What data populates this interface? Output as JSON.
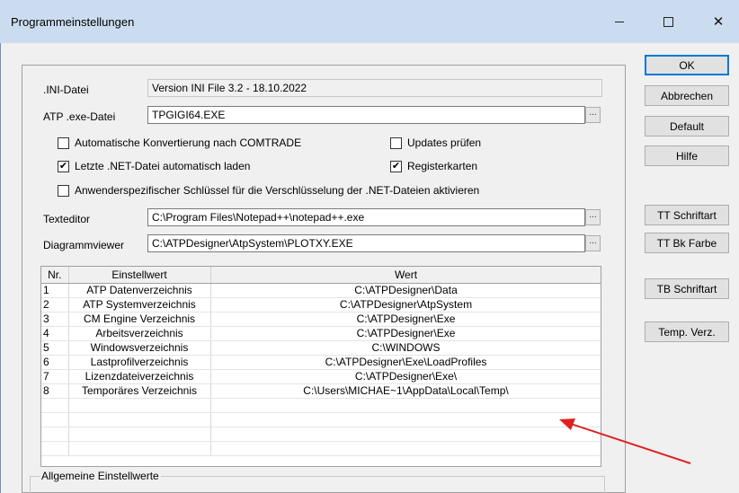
{
  "window": {
    "title": "Programmeinstellungen",
    "minimize": "—",
    "maximize": "",
    "close": "✕"
  },
  "ini": {
    "label": ".INI-Datei",
    "value": "Version INI File 3.2 - 18.10.2022"
  },
  "atp_exe": {
    "label": "ATP .exe-Datei",
    "value": "TPGIGI64.EXE",
    "browse": "..."
  },
  "checkboxes": {
    "auto_convert": {
      "label": "Automatische Konvertierung nach COMTRADE",
      "checked": false,
      "mark": ""
    },
    "updates": {
      "label": "Updates prüfen",
      "checked": false,
      "mark": ""
    },
    "last_net": {
      "label": "Letzte .NET-Datei automatisch laden",
      "checked": true,
      "mark": "✔"
    },
    "tabs": {
      "label": "Registerkarten",
      "checked": true,
      "mark": "✔"
    },
    "encryption": {
      "label": "Anwenderspezifischer Schlüssel für die Verschlüsselung der .NET-Dateien aktivieren",
      "checked": false,
      "mark": ""
    }
  },
  "texteditor": {
    "label": "Texteditor",
    "value": "C:\\Program Files\\Notepad++\\notepad++.exe",
    "browse": "..."
  },
  "diagramviewer": {
    "label": "Diagrammviewer",
    "value": "C:\\ATPDesigner\\AtpSystem\\PLOTXY.EXE",
    "browse": "..."
  },
  "grid": {
    "headers": [
      "Nr.",
      "Einstellwert",
      "Wert"
    ],
    "rows": [
      {
        "nr": "1",
        "name": "ATP Datenverzeichnis",
        "value": "C:\\ATPDesigner\\Data"
      },
      {
        "nr": "2",
        "name": "ATP Systemverzeichnis",
        "value": "C:\\ATPDesigner\\AtpSystem"
      },
      {
        "nr": "3",
        "name": "CM Engine Verzeichnis",
        "value": "C:\\ATPDesigner\\Exe"
      },
      {
        "nr": "4",
        "name": "Arbeitsverzeichnis",
        "value": "C:\\ATPDesigner\\Exe"
      },
      {
        "nr": "5",
        "name": "Windowsverzeichnis",
        "value": "C:\\WINDOWS"
      },
      {
        "nr": "6",
        "name": "Lastprofilverzeichnis",
        "value": "C:\\ATPDesigner\\Exe\\LoadProfiles"
      },
      {
        "nr": "7",
        "name": "Lizenzdateiverzeichnis",
        "value": "C:\\ATPDesigner\\Exe\\"
      },
      {
        "nr": "8",
        "name": "Temporäres Verzeichnis",
        "value": "C:\\Users\\MICHAE~1\\AppData\\Local\\Temp\\"
      },
      {
        "nr": "",
        "name": "",
        "value": ""
      },
      {
        "nr": "",
        "name": "",
        "value": ""
      },
      {
        "nr": "",
        "name": "",
        "value": ""
      },
      {
        "nr": "",
        "name": "",
        "value": ""
      }
    ]
  },
  "general_group": {
    "label": "Allgemeine Einstellwerte"
  },
  "buttons": {
    "ok": "OK",
    "cancel": "Abbrechen",
    "default": "Default",
    "help": "Hilfe",
    "tt_font": "TT Schriftart",
    "tt_bk_color": "TT Bk Farbe",
    "tb_font": "TB Schriftart",
    "temp_dir": "Temp. Verz."
  },
  "colors": {
    "titlebar": "#ccdcf0",
    "arrow": "#e02020",
    "default_button_border": "#0078d7"
  }
}
